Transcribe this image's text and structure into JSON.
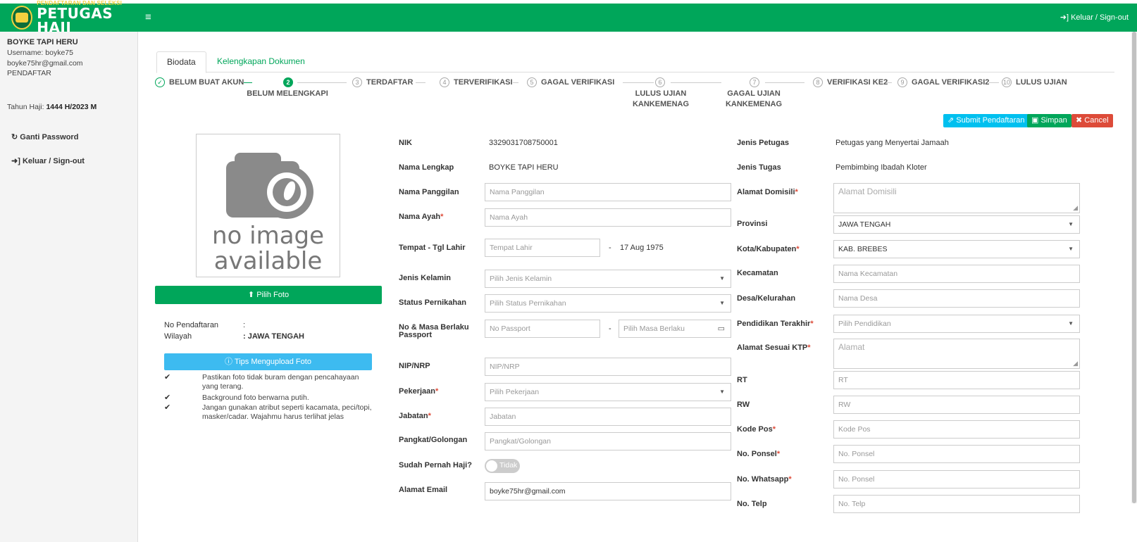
{
  "header": {
    "brand_small": "PENDAFTARAN DAN SELEKSI",
    "brand_big": "PETUGAS HAJI",
    "menu_icon": "≡",
    "signout": "➜] Keluar / Sign-out"
  },
  "sidebar": {
    "name": "BOYKE TAPI HERU",
    "username": "Username: boyke75",
    "email": "boyke75hr@gmail.com",
    "role": "PENDAFTAR",
    "tahun_label": "Tahun Haji: ",
    "tahun_value": "1444 H/2023 M",
    "ganti_password": "Ganti Password",
    "signout": "Keluar / Sign-out"
  },
  "tabs": {
    "biodata": "Biodata",
    "dokumen": "Kelengkapan Dokumen"
  },
  "steps": {
    "s1": "BELUM BUAT AKUN",
    "s2_num": "2",
    "s2": "BELUM MELENGKAPI",
    "s3_num": "3",
    "s3": "TERDAFTAR",
    "s4_num": "4",
    "s4": "TERVERIFIKASI",
    "s5_num": "5",
    "s5": "GAGAL VERIFIKASI",
    "s6_num": "6",
    "s6a": "LULUS UJIAN",
    "s6b": "KANKEMENAG",
    "s7_num": "7",
    "s7a": "GAGAL UJIAN",
    "s7b": "KANKEMENAG",
    "s8_num": "8",
    "s8": "VERIFIKASI KE2",
    "s9_num": "9",
    "s9": "GAGAL VERIFIKASI2",
    "s10_num": "10",
    "s10": "LULUS UJIAN"
  },
  "actions": {
    "submit": "Submit Pendaftaran",
    "simpan": "Simpan",
    "cancel": "Cancel"
  },
  "photo": {
    "noimg1": "no image",
    "noimg2": "available",
    "pilih_foto": "Pilih Foto",
    "no_pendaftaran_label": "No Pendaftaran",
    "no_pendaftaran_value": ":",
    "wilayah_label": "Wilayah",
    "wilayah_value": ": JAWA TENGAH",
    "tips_button": "ⓘ Tips Mengupload Foto",
    "tip1": "Pastikan foto tidak buram dengan pencahayaan yang terang.",
    "tip2": "Background foto berwarna putih.",
    "tip3": "Jangan gunakan atribut seperti kacamata, peci/topi, masker/cadar. Wajahmu harus terlihat jelas"
  },
  "form_left": {
    "nik_label": "NIK",
    "nik_value": "3329031708750001",
    "nama_lengkap_label": "Nama Lengkap",
    "nama_lengkap_value": "BOYKE TAPI HERU",
    "nama_panggilan_label": "Nama Panggilan",
    "nama_panggilan_ph": "Nama Panggilan",
    "nama_ayah_label": "Nama Ayah",
    "nama_ayah_ph": "Nama Ayah",
    "ttl_label": "Tempat - Tgl Lahir",
    "tempat_lahir_ph": "Tempat Lahir",
    "dash": "-",
    "tgl_lahir_value": "17 Aug 1975",
    "jenis_kelamin_label": "Jenis Kelamin",
    "jenis_kelamin_ph": "Pilih Jenis Kelamin",
    "status_label": "Status Pernikahan",
    "status_ph": "Pilih Status Pernikahan",
    "passport_label1": "No & Masa Berlaku",
    "passport_label2": "Passport",
    "passport_ph": "No Passport",
    "masa_berlaku_ph": "Pilih Masa Berlaku",
    "nip_label": "NIP/NRP",
    "nip_ph": "NIP/NRP",
    "pekerjaan_label": "Pekerjaan",
    "pekerjaan_ph": "Pilih Pekerjaan",
    "jabatan_label": "Jabatan",
    "jabatan_ph": "Jabatan",
    "pangkat_label": "Pangkat/Golongan",
    "pangkat_ph": "Pangkat/Golongan",
    "haji_label": "Sudah Pernah Haji?",
    "haji_toggle": "Tidak",
    "email_label": "Alamat Email",
    "email_value": "boyke75hr@gmail.com"
  },
  "form_right": {
    "jenis_petugas_label": "Jenis Petugas",
    "jenis_petugas_value": "Petugas yang Menyertai Jamaah",
    "jenis_tugas_label": "Jenis Tugas",
    "jenis_tugas_value": "Pembimbing Ibadah Kloter",
    "alamat_domisili_label": "Alamat Domisili",
    "alamat_domisili_ph": "Alamat Domisili",
    "provinsi_label": "Provinsi",
    "provinsi_value": "JAWA TENGAH",
    "kota_label": "Kota/Kabupaten",
    "kota_value": "KAB. BREBES",
    "kecamatan_label": "Kecamatan",
    "kecamatan_ph": "Nama Kecamatan",
    "desa_label": "Desa/Kelurahan",
    "desa_ph": "Nama Desa",
    "pendidikan_label": "Pendidikan Terakhir",
    "pendidikan_ph": "Pilih Pendidikan",
    "alamat_ktp_label": "Alamat Sesuai KTP",
    "alamat_ktp_ph": "Alamat",
    "rt_label": "RT",
    "rt_ph": "RT",
    "rw_label": "RW",
    "rw_ph": "RW",
    "kodepos_label": "Kode Pos",
    "kodepos_ph": "Kode Pos",
    "ponsel_label": "No. Ponsel",
    "ponsel_ph": "No. Ponsel",
    "whatsapp_label": "No. Whatsapp",
    "whatsapp_ph": "No. Ponsel",
    "telp_label": "No. Telp",
    "telp_ph": "No. Telp"
  },
  "common": {
    "required_mark": "*",
    "caret": "▼",
    "check": "✔",
    "calendar": "▭"
  },
  "colors": {
    "brand_green": "#00a65a",
    "info_blue": "#00c0ef",
    "danger_red": "#dd4b39"
  }
}
